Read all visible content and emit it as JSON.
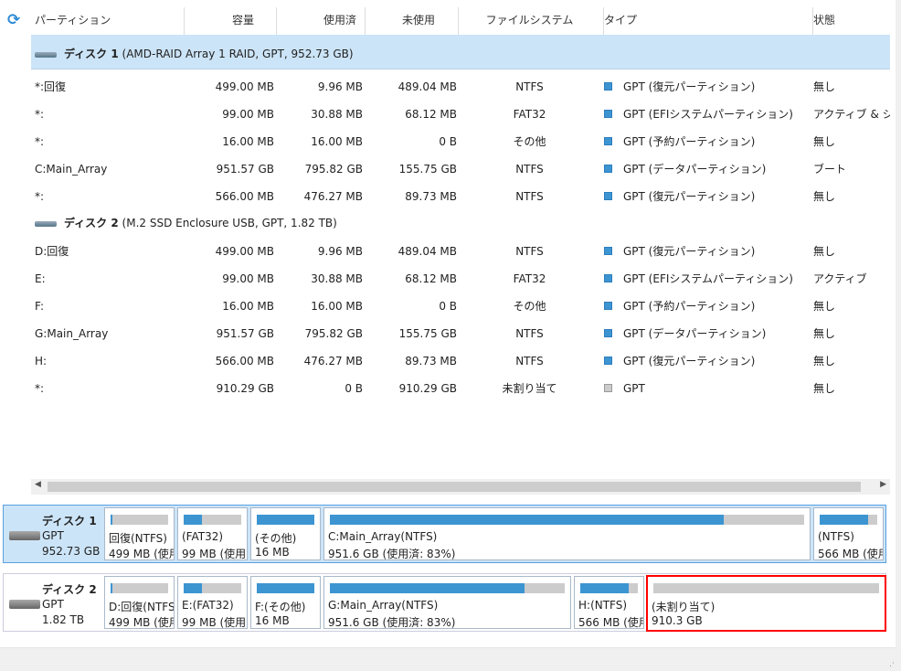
{
  "columns": [
    "パーティション",
    "容量",
    "使用済",
    "未使用",
    "ファイルシステム",
    "タイプ",
    "状態"
  ],
  "disks": [
    {
      "name": "ディスク 1",
      "detail": "(AMD-RAID Array 1 RAID, GPT, 952.73 GB)",
      "style": "GPT",
      "size": "952.73 GB",
      "rows": [
        {
          "partition": "*:回復",
          "capacity": "499.00 MB",
          "used": "9.96 MB",
          "unused": "489.04 MB",
          "fs": "NTFS",
          "type": "GPT (復元パーティション)",
          "status": "無し"
        },
        {
          "partition": "*:",
          "capacity": "99.00 MB",
          "used": "30.88 MB",
          "unused": "68.12 MB",
          "fs": "FAT32",
          "type": "GPT (EFIシステムパーティション)",
          "status": "アクティブ & シ..."
        },
        {
          "partition": "*:",
          "capacity": "16.00 MB",
          "used": "16.00 MB",
          "unused": "0 B",
          "fs": "その他",
          "type": "GPT (予約パーティション)",
          "status": "無し"
        },
        {
          "partition": "C:Main_Array",
          "capacity": "951.57 GB",
          "used": "795.82 GB",
          "unused": "155.75 GB",
          "fs": "NTFS",
          "type": "GPT (データパーティション)",
          "status": "ブート"
        },
        {
          "partition": "*:",
          "capacity": "566.00 MB",
          "used": "476.27 MB",
          "unused": "89.73 MB",
          "fs": "NTFS",
          "type": "GPT (復元パーティション)",
          "status": "無し"
        }
      ],
      "blocks": [
        {
          "label": "回復(NTFS)",
          "info": "499 MB (使用",
          "used_pct": 2
        },
        {
          "label": "(FAT32)",
          "info": "99 MB (使用",
          "used_pct": 31
        },
        {
          "label": "(その他)",
          "info": "16 MB",
          "used_pct": 100
        },
        {
          "label": "C:Main_Array(NTFS)",
          "info": "951.6 GB (使用済: 83%)",
          "used_pct": 83
        },
        {
          "label": "(NTFS)",
          "info": "566 MB (使用",
          "used_pct": 84
        }
      ]
    },
    {
      "name": "ディスク 2",
      "detail": "(M.2 SSD Enclosure USB, GPT, 1.82 TB)",
      "style": "GPT",
      "size": "1.82 TB",
      "rows": [
        {
          "partition": "D:回復",
          "capacity": "499.00 MB",
          "used": "9.96 MB",
          "unused": "489.04 MB",
          "fs": "NTFS",
          "type": "GPT (復元パーティション)",
          "status": "無し"
        },
        {
          "partition": "E:",
          "capacity": "99.00 MB",
          "used": "30.88 MB",
          "unused": "68.12 MB",
          "fs": "FAT32",
          "type": "GPT (EFIシステムパーティション)",
          "status": "アクティブ"
        },
        {
          "partition": "F:",
          "capacity": "16.00 MB",
          "used": "16.00 MB",
          "unused": "0 B",
          "fs": "その他",
          "type": "GPT (予約パーティション)",
          "status": "無し"
        },
        {
          "partition": "G:Main_Array",
          "capacity": "951.57 GB",
          "used": "795.82 GB",
          "unused": "155.75 GB",
          "fs": "NTFS",
          "type": "GPT (データパーティション)",
          "status": "無し"
        },
        {
          "partition": "H:",
          "capacity": "566.00 MB",
          "used": "476.27 MB",
          "unused": "89.73 MB",
          "fs": "NTFS",
          "type": "GPT (復元パーティション)",
          "status": "無し"
        },
        {
          "partition": "*:",
          "capacity": "910.29 GB",
          "used": "0 B",
          "unused": "910.29 GB",
          "fs": "未割り当て",
          "type": "GPT",
          "status": "無し",
          "unallocated": true
        }
      ],
      "blocks": [
        {
          "label": "D:回復(NTFS)",
          "info": "499 MB (使用",
          "used_pct": 2
        },
        {
          "label": "E:(FAT32)",
          "info": "99 MB (使用",
          "used_pct": 31
        },
        {
          "label": "F:(その他)",
          "info": "16 MB",
          "used_pct": 100
        },
        {
          "label": "G:Main_Array(NTFS)",
          "info": "951.6 GB (使用済: 83%)",
          "used_pct": 83
        },
        {
          "label": "H:(NTFS)",
          "info": "566 MB (使用",
          "used_pct": 84
        },
        {
          "label": "(未割り当て)",
          "info": "910.3 GB",
          "used_pct": 0,
          "highlighted": true
        }
      ]
    }
  ],
  "colors": {
    "accent": "#3c95d1",
    "selected": "#cce4f7",
    "highlight": "#ff0000"
  }
}
